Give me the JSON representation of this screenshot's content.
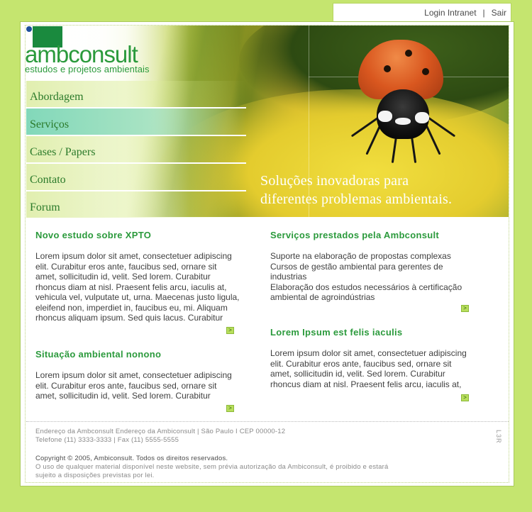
{
  "topbar": {
    "login": "Login Intranet",
    "sep": "|",
    "logout": "Sair"
  },
  "logo": {
    "word": "ambconsult",
    "subtitle": "estudos e projetos ambientais"
  },
  "nav": [
    {
      "label": "Abordagem"
    },
    {
      "label": "Serviços"
    },
    {
      "label": "Cases / Papers"
    },
    {
      "label": "Contato"
    },
    {
      "label": "Forum"
    }
  ],
  "banner": {
    "tagline_1": "Soluções inovadoras para",
    "tagline_2": "diferentes problemas ambientais."
  },
  "left": {
    "sections": [
      {
        "title": "Novo estudo sobre XPTO",
        "lines": [
          "Lorem ipsum dolor sit amet, consectetuer adipiscing",
          "elit. Curabitur eros ante, faucibus sed, ornare sit",
          "amet, sollicitudin id, velit. Sed lorem. Curabitur",
          "rhoncus diam at nisl. Praesent felis arcu, iaculis at,",
          "vehicula vel, vulputate ut, urna. Maecenas justo ligula,",
          "eleifend non, imperdiet in, faucibus eu, mi. Aliquam",
          "rhoncus aliquam ipsum. Sed quis lacus. Curabitur"
        ]
      },
      {
        "title": "Situação ambiental nonono",
        "lines": [
          "Lorem ipsum dolor sit amet, consectetuer adipiscing",
          "elit. Curabitur eros ante, faucibus sed, ornare sit",
          "amet, sollicitudin id, velit. Sed lorem. Curabitur"
        ]
      }
    ]
  },
  "right": {
    "sections": [
      {
        "title": "Serviços prestados pela Ambconsult",
        "lines": [
          "Suporte na elaboração de propostas complexas",
          "Cursos de gestão ambiental para gerentes de",
          "industrias",
          "Elaboração dos estudos necessários à certificação",
          "ambiental de agroindústrias"
        ]
      },
      {
        "title": "Lorem Ipsum est felis iaculis",
        "lines": [
          "Lorem ipsum dolor sit amet, consectetuer adipiscing",
          "elit. Curabitur eros ante, faucibus sed, ornare sit",
          "amet, sollicitudin id, velit. Sed lorem. Curabitur",
          "rhoncus diam at nisl. Praesent felis arcu, iaculis at,"
        ]
      }
    ]
  },
  "more_glyph": ">",
  "footer": {
    "address": "Endereço da Ambconsult Endereço da Ambiconsult  |  São Paulo I CEP 00000-12",
    "phone": "Telefone (11) 3333-3333  |  Fax (11) 5555-5555",
    "copyright": "Copyright © 2005, Ambiconsult. Todos os direitos reservados.",
    "notice_1": "O uso de qualquer material disponível neste website, sem prévia autorização da Ambiconsult, é proibido e estará",
    "notice_2": "sujeito a disposições previstas por lei.",
    "badge": "L3R"
  },
  "colors": {
    "page_bg": "#c5e56f",
    "accent_green": "#2b9a3c",
    "nav_active": "#82d8ba",
    "arrow_bg": "#b8df5c"
  }
}
